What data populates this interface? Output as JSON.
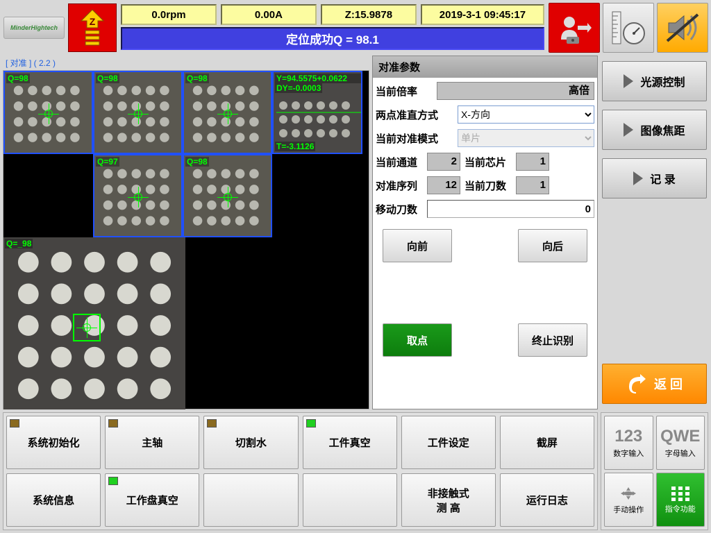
{
  "header": {
    "logo": "MinderHightech",
    "rpm": "0.0rpm",
    "amp": "0.00A",
    "z": "Z:15.9878",
    "datetime": "2019-3-1 09:45:17",
    "banner": "定位成功Q = 98.1"
  },
  "vision": {
    "tag": "[ 对准 ] ( 2.2 )",
    "thumbs": [
      {
        "q": "Q=98"
      },
      {
        "q": "Q=98"
      },
      {
        "q": "Q=98"
      },
      {
        "q": "Q=97"
      },
      {
        "q": "Q=98"
      }
    ],
    "mainQ": "Q=_98",
    "ylab": "Y=94.5575+0.0622",
    "dy": "DY=-0.0003",
    "t": "T=-3.1126"
  },
  "params": {
    "title": "对准参数",
    "rows": {
      "mag_label": "当前倍率",
      "mag_val": "高倍",
      "dir_label": "两点准直方式",
      "dir_val": "X-方向",
      "mode_label": "当前对准模式",
      "mode_val": "单片",
      "chan_label": "当前通道",
      "chan_val": "2",
      "chip_label": "当前芯片",
      "chip_val": "1",
      "seq_label": "对准序列",
      "seq_val": "12",
      "kn_label": "当前刀数",
      "kn_val": "1",
      "mv_label": "移动刀数",
      "mv_val": "0"
    },
    "btns": {
      "fwd": "向前",
      "back": "向后",
      "pick": "取点",
      "stop": "终止识别"
    }
  },
  "right": {
    "b1": "光源控制",
    "b2": "图像焦距",
    "b3": "记 录",
    "ret": "返 回"
  },
  "footer": {
    "b": [
      "系统初始化",
      "主轴",
      "切割水",
      "工件真空",
      "工件设定",
      "截屏",
      "系统信息",
      "工作盘真空",
      "",
      "",
      "非接触式\n测 高",
      "运行日志"
    ],
    "side": {
      "num": "数字输入",
      "alpha": "字母输入",
      "manual": "手动操作",
      "cmd": "指令功能",
      "numIc": "123",
      "alphaIc": "QWE"
    }
  }
}
